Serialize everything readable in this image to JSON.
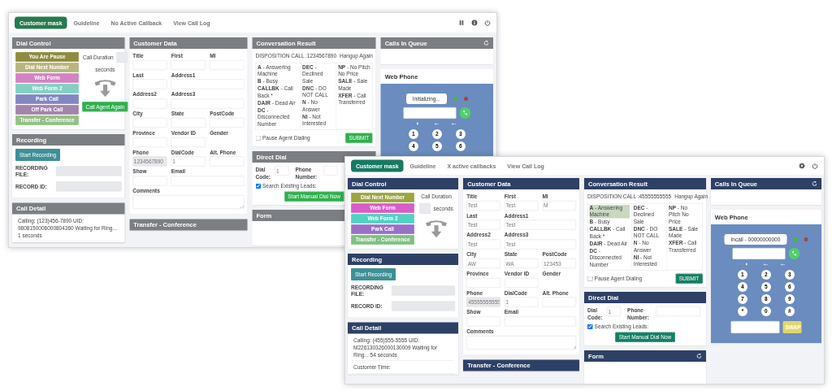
{
  "windows": [
    {
      "color": "#7b7e82",
      "tabs": [
        {
          "label": "Customer mask",
          "selected": true
        },
        {
          "label": "Guideline",
          "selected": false
        },
        {
          "label": "No Active Callback",
          "selected": false
        },
        {
          "label": "View Call Log",
          "selected": false
        }
      ],
      "toolbar": [
        {
          "kind": "pause"
        },
        {
          "kind": "info"
        },
        {
          "kind": "power"
        }
      ],
      "dial_control": {
        "title": "Dial Control",
        "buttons": [
          {
            "label": "You Are Pause",
            "color": "#8f8c3e"
          },
          {
            "label": "Dial Next Number",
            "color": "#b8b57c"
          },
          {
            "label": "Web Form",
            "color": "#d383c4"
          },
          {
            "label": "Web Form 2",
            "color": "#82d0c2"
          },
          {
            "label": "Park Call",
            "color": "#8286c2"
          },
          {
            "label": "Off Park Call",
            "color": "#a384aa"
          },
          {
            "label": "Transfer - Conference",
            "color": "#93c184"
          }
        ],
        "duration_label": "Call Duration",
        "duration_unit": "seconds",
        "action": "Call Agent Again"
      },
      "recording": {
        "title": "Recording",
        "button": "Start Recording",
        "fields": [
          {
            "label": "RECORDING FILE:"
          },
          {
            "label": "RECORD ID:"
          }
        ]
      },
      "call_detail": {
        "title": "Call Detail",
        "lines": [
          "Calling: (123)456-7890 UID: 9808150006000804360  Waiting for Ring... 1 seconds"
        ]
      },
      "customer_data": {
        "title": "Customer Data",
        "rows": [
          [
            {
              "label": "Title",
              "kind": "text"
            },
            {
              "label": "First",
              "kind": "text"
            },
            {
              "label": "MI",
              "kind": "text"
            }
          ],
          [
            {
              "label": "Last",
              "kind": "text"
            },
            {
              "label": "Address1",
              "kind": "text"
            }
          ],
          [
            {
              "label": "Address2",
              "kind": "text"
            },
            {
              "label": "Address3",
              "kind": "text"
            }
          ],
          [
            {
              "label": "City",
              "kind": "text"
            },
            {
              "label": "State",
              "kind": "text"
            },
            {
              "label": "PostCode",
              "kind": "text"
            }
          ],
          [
            {
              "label": "Province",
              "kind": "text"
            },
            {
              "label": "Vendor ID",
              "kind": "text"
            },
            {
              "label": "Gender",
              "kind": "none"
            }
          ],
          [
            {
              "label": "Phone",
              "kind": "readonly",
              "value": "1234567890"
            },
            {
              "label": "DialCode",
              "kind": "text",
              "value": "1"
            },
            {
              "label": "Alt. Phone",
              "kind": "text"
            }
          ],
          [
            {
              "label": "Show",
              "kind": "text"
            },
            {
              "label": "Email",
              "kind": "text"
            }
          ]
        ],
        "comments": "Comments"
      },
      "transfer": {
        "title": "Transfer - Conference"
      },
      "conversation": {
        "title": "Conversation Result",
        "disposition": "DISPOSITION CALL :1234567890",
        "hangup": "Hangup Again",
        "columns": [
          [
            {
              "text": "**A** - Answering Machine",
              "selected": false
            },
            {
              "text": "**B** - Busy",
              "selected": false
            },
            {
              "text": "**CALLBK** - Call Back *",
              "selected": false
            },
            {
              "text": "**DAIR** - Dead Air",
              "selected": false
            },
            {
              "text": "**DC** - Disconnected Number",
              "selected": false
            }
          ],
          [
            {
              "text": "**DEC** - Declined Sale",
              "selected": false
            },
            {
              "text": "**DNC** - DO NOT CALL",
              "selected": false
            },
            {
              "text": "**N** - No Answer",
              "selected": false
            },
            {
              "text": "**NI** - Not Interested",
              "selected": false
            }
          ],
          [
            {
              "text": "**NP** - No Pitch No Price",
              "selected": false
            },
            {
              "text": "**SALE** - Sale Made",
              "selected": false
            },
            {
              "text": "**XFER** - Call Transferred",
              "selected": false
            }
          ]
        ],
        "pause": {
          "label": "Pause Agent Dialing",
          "checked": false
        },
        "submit": "SUBMIT"
      },
      "direct_dial": {
        "title": "Direct Dial",
        "dial_code_label": "Dial Code:",
        "dial_code": "1",
        "phone_label": "Phone Number:",
        "search": {
          "label": "Search Existing Leads:",
          "checked": true
        },
        "button": "Start Manual Dial Now"
      },
      "form": {
        "title": "Form",
        "refresh": false
      },
      "queue": {
        "title": "Calls In Queue",
        "refresh": true
      },
      "web_phone": {
        "title": "Web Phone",
        "status": "Initializing...",
        "keys": [
          "1",
          "2",
          "3",
          "4",
          "5",
          "6"
        ]
      }
    },
    {
      "color": "#2e4066",
      "tabs": [
        {
          "label": "Customer mask",
          "selected": true
        },
        {
          "label": "Guideline",
          "selected": false
        },
        {
          "label": "X active callbacks",
          "selected": false
        },
        {
          "label": "View Call Log",
          "selected": false
        }
      ],
      "toolbar": [
        {
          "kind": "settings"
        },
        {
          "kind": "power"
        }
      ],
      "dial_control": {
        "title": "Dial Control",
        "buttons": [
          {
            "label": "Dial Next Number",
            "color": "#9ba640"
          },
          {
            "label": "Web Form",
            "color": "#d95ccb"
          },
          {
            "label": "Web Form 2",
            "color": "#52d1c1"
          },
          {
            "label": "Park Call",
            "color": "#9a70c6"
          },
          {
            "label": "Transfer - Conference",
            "color": "#7fc282"
          }
        ],
        "duration_label": "Call Duration",
        "duration_unit": "seconds"
      },
      "recording": {
        "title": "Recording",
        "button": "Start Recording",
        "fields": [
          {
            "label": "RECORDING FILE:"
          },
          {
            "label": "RECORD ID:"
          }
        ]
      },
      "call_detail": {
        "title": "Call Detail",
        "lines": [
          "Calling: (455)555-5555 UID: M226130326000130009  Waiting for Ring... 54 seconds",
          "Customer Time:"
        ]
      },
      "customer_data": {
        "title": "Customer Data",
        "rows": [
          [
            {
              "label": "Title",
              "kind": "text",
              "value": "Test"
            },
            {
              "label": "First",
              "kind": "text",
              "value": "Test"
            },
            {
              "label": "MI",
              "kind": "text",
              "value": "M"
            }
          ],
          [
            {
              "label": "Last",
              "kind": "text",
              "value": "Test"
            },
            {
              "label": "Address1",
              "kind": "text",
              "value": "Test"
            }
          ],
          [
            {
              "label": "Address2",
              "kind": "text",
              "value": "Test"
            },
            {
              "label": "Address3",
              "kind": "text",
              "value": "Test"
            }
          ],
          [
            {
              "label": "City",
              "kind": "text",
              "value": "AW"
            },
            {
              "label": "State",
              "kind": "text",
              "value": "WA"
            },
            {
              "label": "PostCode",
              "kind": "text",
              "value": "123453"
            }
          ],
          [
            {
              "label": "Province",
              "kind": "text"
            },
            {
              "label": "Vendor ID",
              "kind": "text"
            },
            {
              "label": "Gender",
              "kind": "none"
            }
          ],
          [
            {
              "label": "Phone",
              "kind": "readonly",
              "value": "45555555555"
            },
            {
              "label": "DialCode",
              "kind": "text",
              "value": "1"
            },
            {
              "label": "Alt. Phone",
              "kind": "text"
            }
          ],
          [
            {
              "label": "Show",
              "kind": "text"
            },
            {
              "label": "Email",
              "kind": "text"
            }
          ]
        ],
        "comments": "Comments"
      },
      "transfer": {
        "title": "Transfer - Conference"
      },
      "conversation": {
        "title": "Conversation Result",
        "disposition": "DISPOSITION CALL :45555555555",
        "hangup": "Hangup Again",
        "columns": [
          [
            {
              "text": "**A** - Answering Machine",
              "selected": true
            },
            {
              "text": "**B** - Busy",
              "selected": false
            },
            {
              "text": "**CALLBK** - Call Back *",
              "selected": false
            },
            {
              "text": "**DAIR** - Dead Air",
              "selected": false
            },
            {
              "text": "**DC** - Disconnected Number",
              "selected": false
            }
          ],
          [
            {
              "text": "**DEC** - Declined Sale",
              "selected": false
            },
            {
              "text": "**DNC** - DO NOT CALL",
              "selected": false
            },
            {
              "text": "**N** - No Answer",
              "selected": false
            },
            {
              "text": "**NI** - Not Interested",
              "selected": false
            }
          ],
          [
            {
              "text": "**NP** - No Pitch No Price",
              "selected": false
            },
            {
              "text": "**SALE** - Sale Made",
              "selected": false
            },
            {
              "text": "**XFER** - Call Transferred",
              "selected": false
            }
          ]
        ],
        "pause": {
          "label": "Pause Agent Dialing",
          "checked": false
        },
        "submit": "SUBMIT"
      },
      "direct_dial": {
        "title": "Direct Dial",
        "dial_code_label": "Dial Code:",
        "dial_code": "1",
        "phone_label": "Phone Number:",
        "search": {
          "label": "Search Existing Leads:",
          "checked": true
        },
        "button": "Start Manual Dial Now"
      },
      "form": {
        "title": "Form",
        "refresh": true
      },
      "queue": {
        "title": "Calls In Queue",
        "refresh": true
      },
      "web_phone": {
        "title": "Web Phone",
        "status": "Incall - 00000000000",
        "keys": [
          "1",
          "2",
          "3",
          "4",
          "5",
          "6",
          "7",
          "8",
          "9",
          "*",
          "0",
          "#"
        ],
        "swap": "SWAP"
      }
    }
  ]
}
